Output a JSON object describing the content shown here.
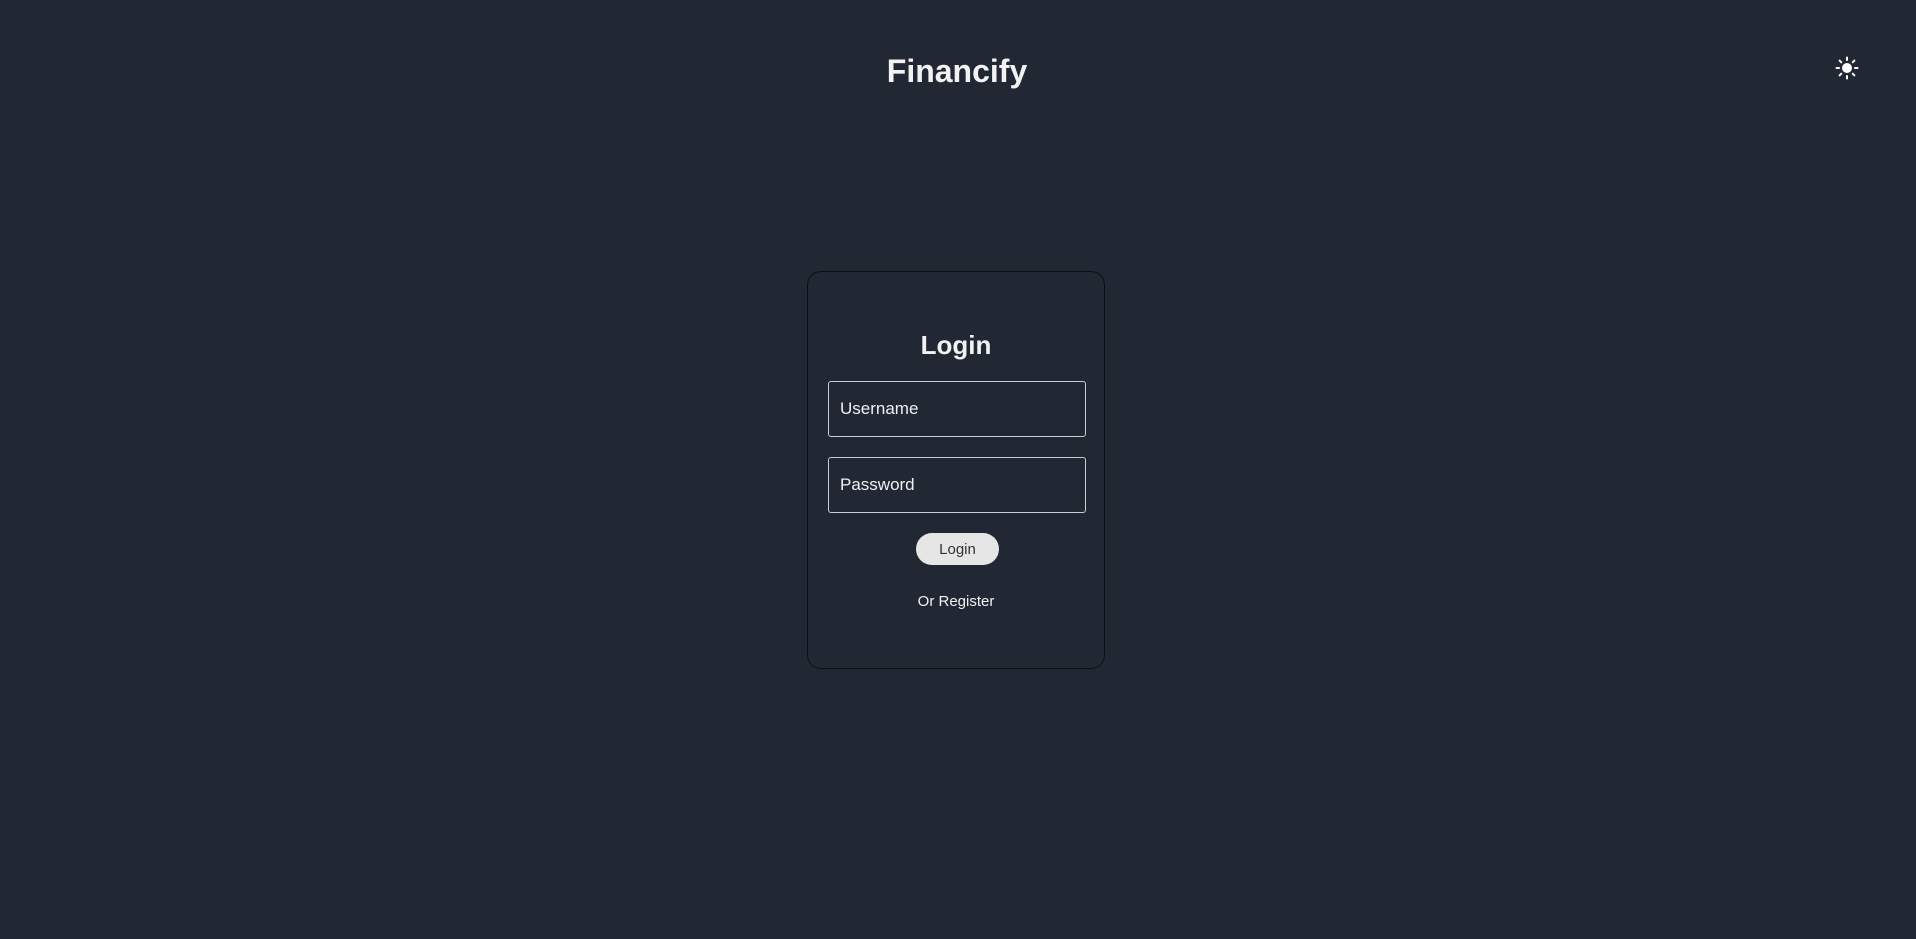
{
  "header": {
    "title": "Financify",
    "theme_icon": "sun-icon"
  },
  "login": {
    "title": "Login",
    "username_placeholder": "Username",
    "username_value": "",
    "password_placeholder": "Password",
    "password_value": "",
    "button_label": "Login",
    "register_text": "Or Register"
  },
  "colors": {
    "background": "#222833",
    "text": "#f2f2f2",
    "button_background": "#e6e6e6",
    "field_border": "#c9ccd1"
  }
}
